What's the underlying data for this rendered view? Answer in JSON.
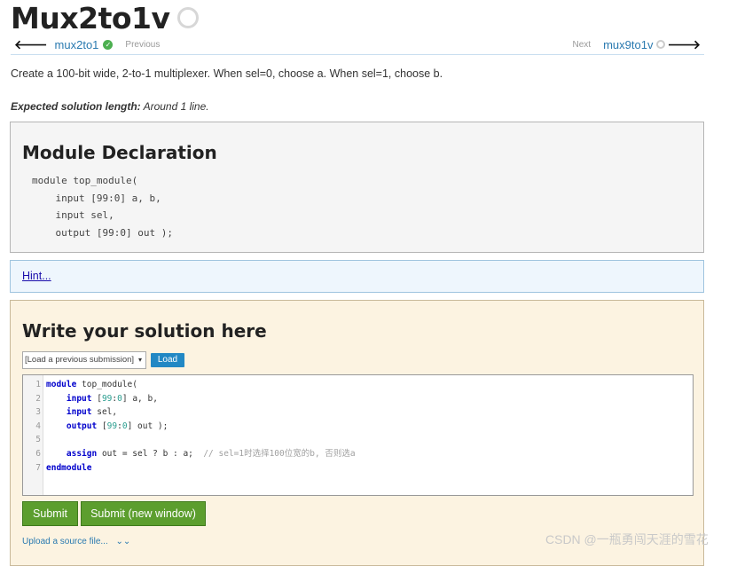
{
  "header": {
    "title": "Mux2to1v"
  },
  "nav": {
    "prev_link": "mux2to1",
    "prev_label": "Previous",
    "next_label": "Next",
    "next_link": "mux9to1v"
  },
  "description": "Create a 100-bit wide, 2-to-1 multiplexer. When sel=0, choose a. When sel=1, choose b.",
  "expected": {
    "label": "Expected solution length:",
    "value": "Around 1 line."
  },
  "declaration": {
    "heading": "Module Declaration",
    "code": "module top_module(\n    input [99:0] a, b,\n    input sel,\n    output [99:0] out );"
  },
  "hint": {
    "label": "Hint..."
  },
  "solution": {
    "heading": "Write your solution here",
    "load_select_value": "[Load a previous submission]",
    "load_button": "Load",
    "line_numbers": [
      "1",
      "2",
      "3",
      "4",
      "5",
      "6",
      "7"
    ],
    "code_lines": [
      [
        {
          "t": "module",
          "c": "kw"
        },
        {
          "t": " top_module(",
          "c": ""
        }
      ],
      [
        {
          "t": "    ",
          "c": ""
        },
        {
          "t": "input",
          "c": "kw"
        },
        {
          "t": " [",
          "c": ""
        },
        {
          "t": "99",
          "c": "num"
        },
        {
          "t": ":",
          "c": ""
        },
        {
          "t": "0",
          "c": "num"
        },
        {
          "t": "] a, b,",
          "c": ""
        }
      ],
      [
        {
          "t": "    ",
          "c": ""
        },
        {
          "t": "input",
          "c": "kw"
        },
        {
          "t": " sel,",
          "c": ""
        }
      ],
      [
        {
          "t": "    ",
          "c": ""
        },
        {
          "t": "output",
          "c": "kw"
        },
        {
          "t": " [",
          "c": ""
        },
        {
          "t": "99",
          "c": "num"
        },
        {
          "t": ":",
          "c": ""
        },
        {
          "t": "0",
          "c": "num"
        },
        {
          "t": "] out );",
          "c": ""
        }
      ],
      [
        {
          "t": "",
          "c": ""
        }
      ],
      [
        {
          "t": "    ",
          "c": ""
        },
        {
          "t": "assign",
          "c": "kw"
        },
        {
          "t": " out = sel ? b : a;  ",
          "c": ""
        },
        {
          "t": "// sel=1时选择100位宽的b, 否则选a",
          "c": "cm"
        }
      ],
      [
        {
          "t": "endmodule",
          "c": "kw"
        }
      ]
    ],
    "submit_button": "Submit",
    "submit_new_window_button": "Submit (new window)",
    "upload_link": "Upload a source file...",
    "upload_expand": "⌄⌄"
  },
  "watermark": "CSDN @一瓶勇闯天涯的雪花",
  "colors": {
    "link": "#2a7ab0",
    "submit": "#5c9e2e",
    "load": "#2288c4",
    "solution_bg": "#fcf3e1",
    "hint_bg": "#eef6fd",
    "keyword": "#0000cc"
  }
}
